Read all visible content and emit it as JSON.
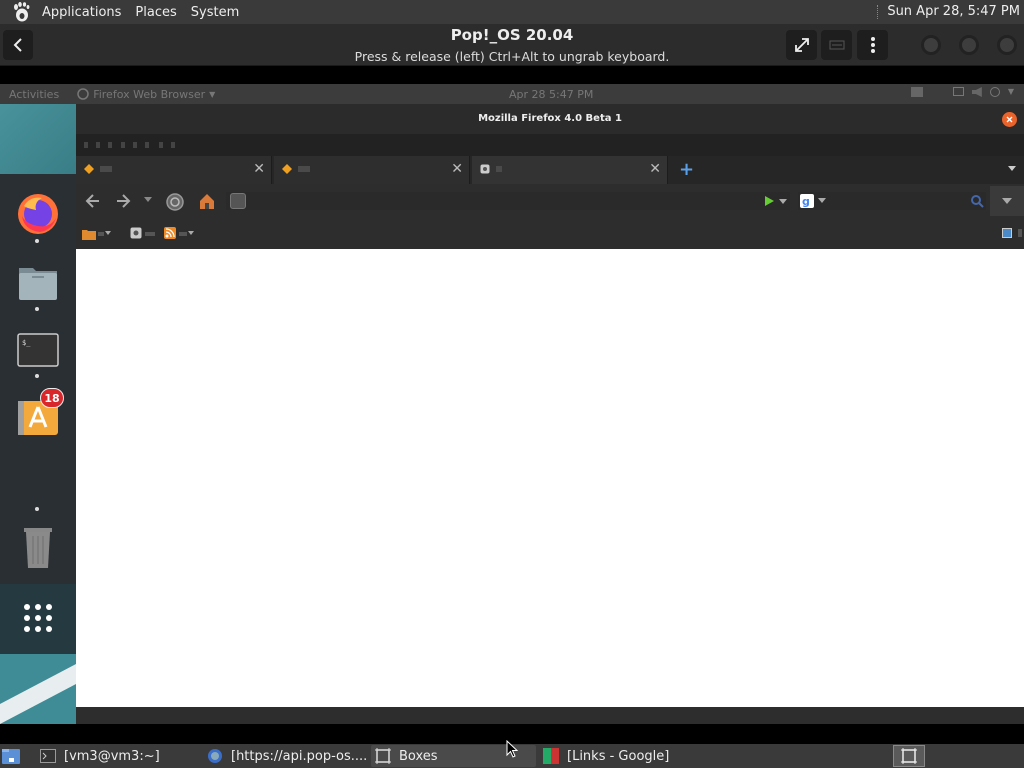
{
  "host_panel": {
    "menus": [
      "Applications",
      "Places",
      "System"
    ],
    "clock": "Sun Apr 28,  5:47 PM"
  },
  "boxes": {
    "title": "Pop!_OS 20.04",
    "subtitle": "Press & release (left) Ctrl+Alt to ungrab keyboard."
  },
  "guest": {
    "topbar": {
      "activities": "Activities",
      "app_name": "Firefox Web Browser",
      "date": "Apr 28  5:47 PM"
    },
    "dock": {
      "apps": [
        "firefox-icon",
        "files-icon",
        "terminal-icon",
        "pop-shop-icon",
        "trash-icon",
        "app-grid-icon"
      ],
      "notification_badge": "18"
    },
    "firefox": {
      "window_title": "Mozilla Firefox 4.0 Beta 1",
      "tabs": [
        {
          "icon": "warning-icon",
          "active": false
        },
        {
          "icon": "warning-icon",
          "active": false
        },
        {
          "icon": "page-icon",
          "active": true
        }
      ]
    }
  },
  "host_taskbar": {
    "tasks": [
      {
        "label": "[vm3@vm3:~]",
        "icon": "terminal-icon"
      },
      {
        "label": "[https://api.pop-os....",
        "icon": "browser-icon"
      },
      {
        "label": "Boxes",
        "icon": "boxes-icon",
        "active": true
      },
      {
        "label": "[Links - Google]",
        "icon": "links-icon"
      }
    ]
  },
  "colors": {
    "panel_bg": "#3a3a3a",
    "header_bg": "#2c2c2c",
    "dock_teal": "#3f8c96",
    "close_orange": "#e8642c",
    "badge_red": "#d8262b"
  }
}
